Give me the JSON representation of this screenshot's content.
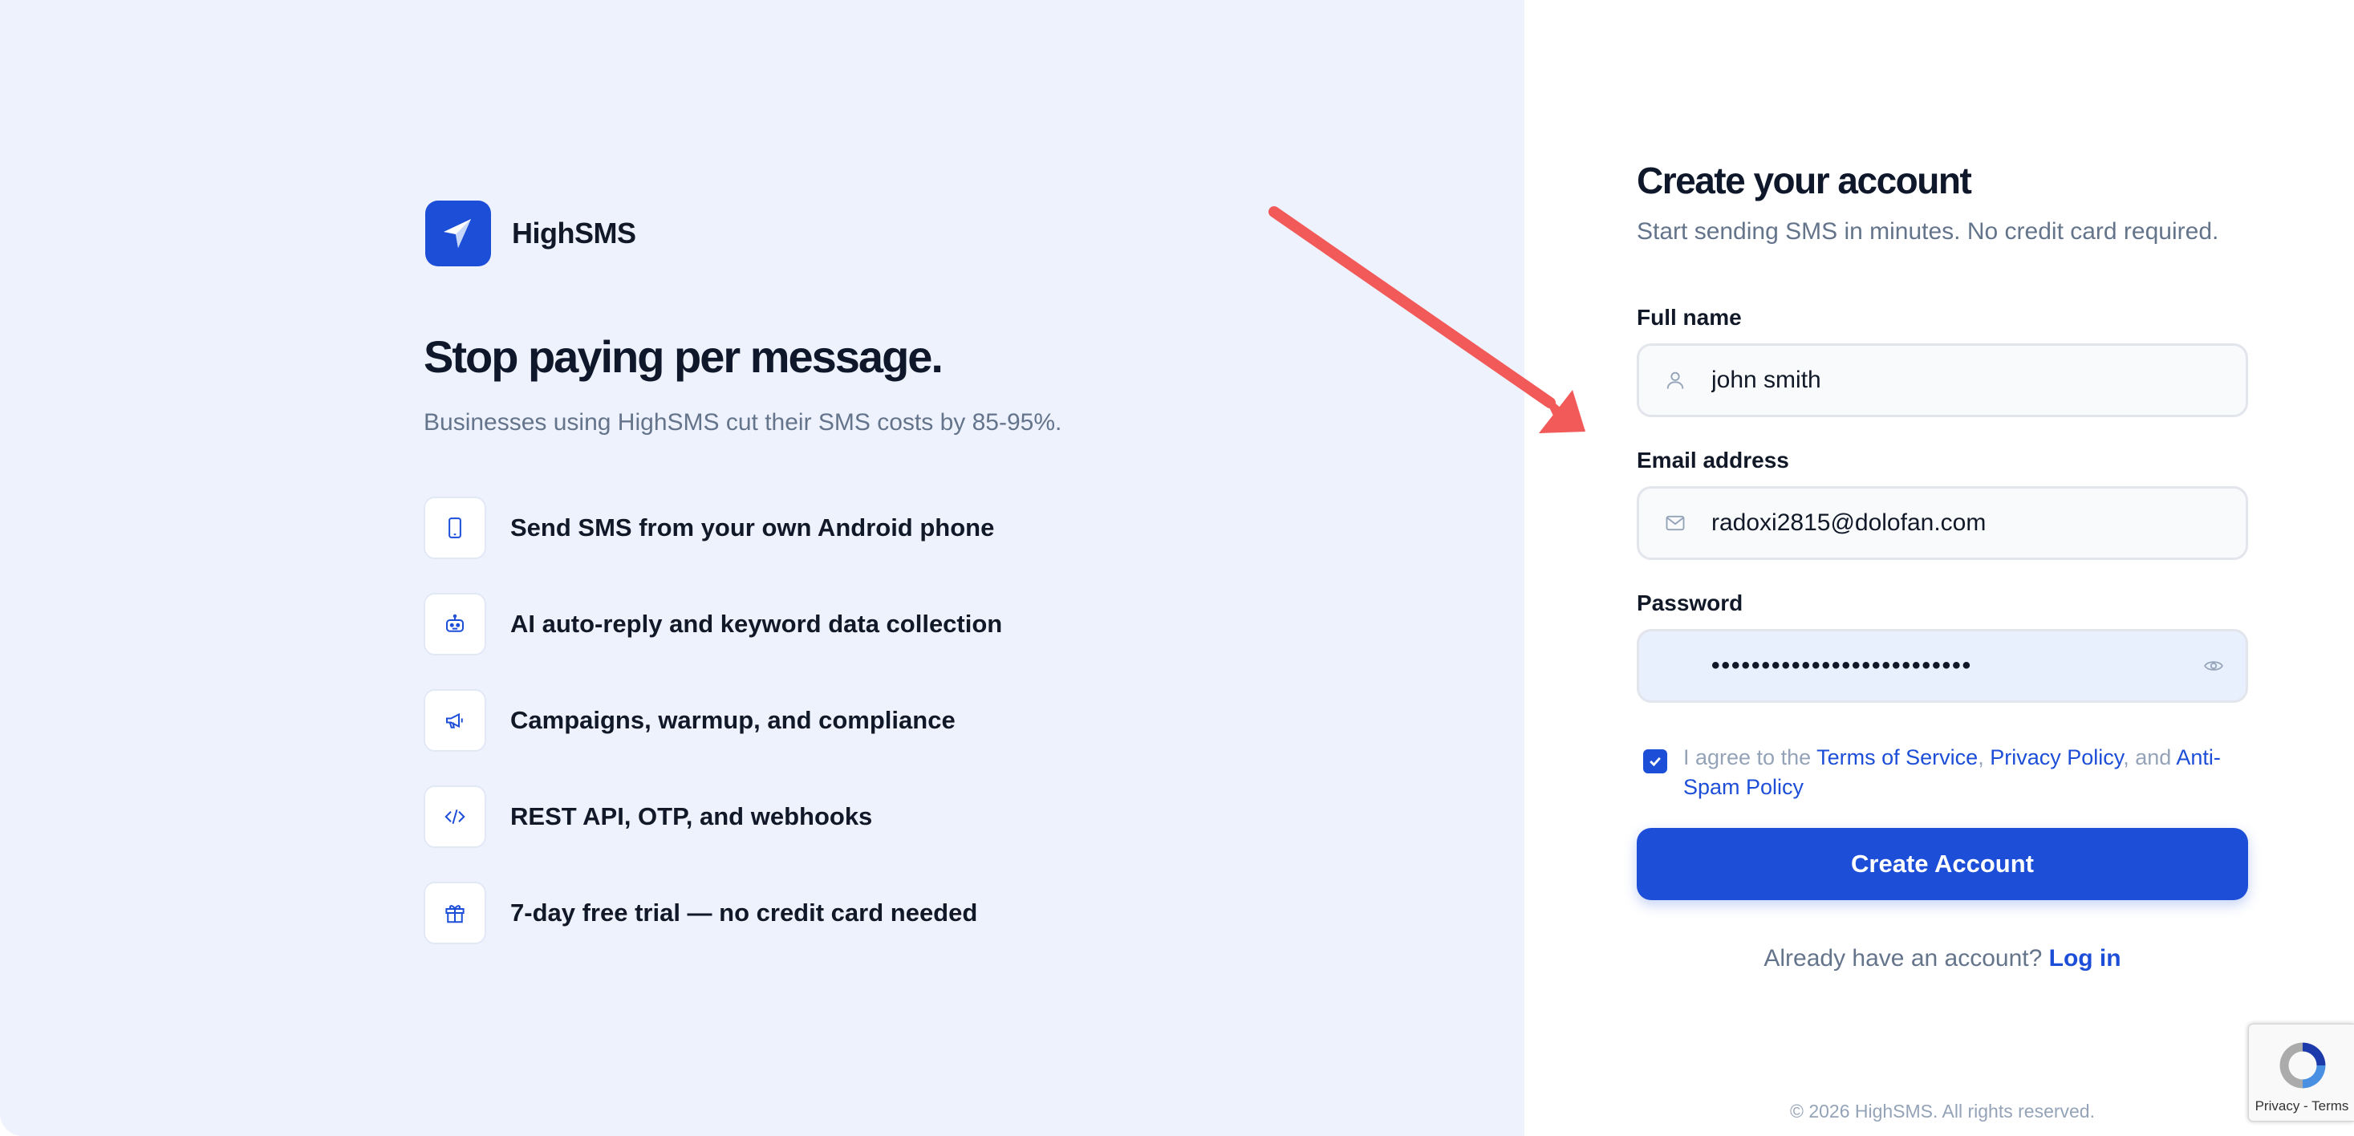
{
  "brand": {
    "name": "HighSMS",
    "accent_color": "#1d4ed8"
  },
  "hero": {
    "headline": "Stop paying per message.",
    "subheadline": "Businesses using HighSMS cut their SMS costs by 85-95%.",
    "features": [
      {
        "icon": "smartphone-icon",
        "label": "Send SMS from your own Android phone"
      },
      {
        "icon": "robot-icon",
        "label": "AI auto-reply and keyword data collection"
      },
      {
        "icon": "megaphone-icon",
        "label": "Campaigns, warmup, and compliance"
      },
      {
        "icon": "code-icon",
        "label": "REST API, OTP, and webhooks"
      },
      {
        "icon": "gift-icon",
        "label": "7-day free trial — no credit card needed"
      }
    ]
  },
  "annotation": {
    "icon": "arrow-icon",
    "color": "#f25a5a"
  },
  "form": {
    "title": "Create your account",
    "subtitle": "Start sending SMS in minutes. No credit card required.",
    "full_name": {
      "label": "Full name",
      "value": "john smith",
      "icon": "user-icon"
    },
    "email": {
      "label": "Email address",
      "value": "radoxi2815@dolofan.com",
      "icon": "mail-icon"
    },
    "password": {
      "label": "Password",
      "masked_value": "••••••••••••••••••••••••••",
      "icon": "eye-icon"
    },
    "agree": {
      "checked": true,
      "prefix": "I agree to the ",
      "terms": "Terms of Service",
      "sep1": ", ",
      "privacy": "Privacy Policy",
      "sep2": ", and ",
      "antispam": "Anti-Spam Policy"
    },
    "submit_label": "Create Account",
    "login_prompt": "Already have an account?",
    "login_link": "Log in"
  },
  "footer": {
    "text": "© 2026 HighSMS. All rights reserved."
  },
  "recaptcha": {
    "text": "Privacy - Terms",
    "icon": "recaptcha-icon"
  }
}
